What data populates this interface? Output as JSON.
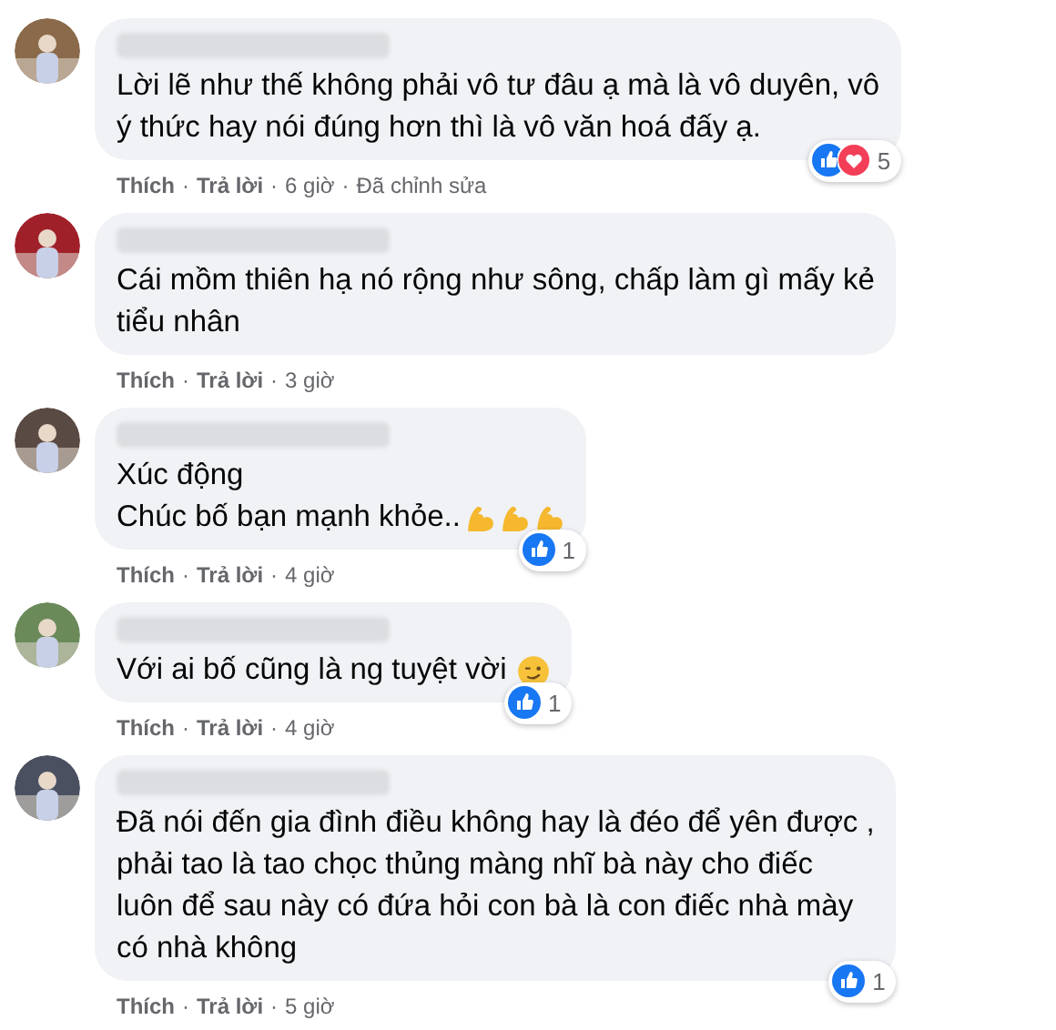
{
  "separator": "·",
  "comments": [
    {
      "lines": [
        "Lời lẽ như thế không phải vô tư đâu ạ mà là vô duyên, vô",
        "ý thức hay nói đúng hơn thì là vô văn hoá đấy ạ."
      ],
      "actions": [
        "Thích",
        "Trả lời"
      ],
      "time": "6 giờ",
      "edited": "Đã chỉnh sửa",
      "reactions": {
        "icons": [
          {
            "kind": "like"
          },
          {
            "kind": "love"
          }
        ],
        "count": "5"
      }
    },
    {
      "lines": [
        "Cái mồm thiên hạ nó rộng như sông, chấp làm gì mấy kẻ",
        "tiểu nhân"
      ],
      "actions": [
        "Thích",
        "Trả lời"
      ],
      "time": "3 giờ"
    },
    {
      "lines": [
        "Xúc động",
        "Chúc bố bạn mạnh khỏe.."
      ],
      "emojis": [
        {
          "kind": "arm"
        },
        {
          "kind": "arm"
        },
        {
          "kind": "arm"
        }
      ],
      "actions": [
        "Thích",
        "Trả lời"
      ],
      "time": "4 giờ",
      "reactions": {
        "icons": [
          {
            "kind": "like"
          }
        ],
        "count": "1"
      }
    },
    {
      "lines": [
        "Với ai bố cũng là ng tuyệt vời"
      ],
      "emojis": [
        {
          "kind": "wink"
        }
      ],
      "actions": [
        "Thích",
        "Trả lời"
      ],
      "time": "4 giờ",
      "reactions": {
        "icons": [
          {
            "kind": "like"
          }
        ],
        "count": "1"
      }
    },
    {
      "lines": [
        "Đã nói đến gia đình điều không hay là đéo để yên được ,",
        "phải tao là tao chọc thủng màng nhĩ bà này cho điếc",
        "luôn để sau này có đứa hỏi con bà là con điếc nhà mày",
        "có nhà không"
      ],
      "actions": [
        "Thích",
        "Trả lời"
      ],
      "time": "5 giờ",
      "reactions": {
        "icons": [
          {
            "kind": "like"
          }
        ],
        "count": "1"
      }
    }
  ]
}
